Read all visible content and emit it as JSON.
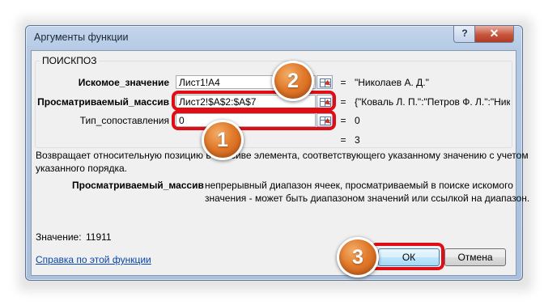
{
  "window": {
    "title": "Аргументы функции",
    "help_glyph": "?",
    "close_glyph": "✕"
  },
  "function_name": "ПОИСКПОЗ",
  "args": [
    {
      "label": "Искомое_значение",
      "bold": true,
      "value": "Лист1!A4",
      "result": "\"Николаев А. Д.\""
    },
    {
      "label": "Просматриваемый_массив",
      "bold": true,
      "value": "Лист2!$A$2:$A$7",
      "result": "{\"Коваль Л. П.\":\"Петров Ф. Л.\":\"Ник"
    },
    {
      "label": "Тип_сопоставления",
      "bold": false,
      "value": "0",
      "result": "0"
    }
  ],
  "equals_sign": "=",
  "total_result": "3",
  "description": {
    "line1": "Возвращает относительную позицию в массиве элемента, соответствующего указанному значению с учетом",
    "line2": "указанного порядка."
  },
  "arg_help": {
    "name": "Просматриваемый_массив",
    "line1": "непрерывный диапазон ячеек, просматриваемый в поиске искомого",
    "line2": "значения - может быть диапазоном значений или ссылкой на диапазон."
  },
  "value_line": {
    "label": "Значение:",
    "value": "11911"
  },
  "help_link": "Справка по этой функции",
  "buttons": {
    "ok": "ОК",
    "cancel": "Отмена"
  },
  "callouts": {
    "one": "1",
    "two": "2",
    "three": "3"
  },
  "accent_colors": {
    "callout_red": "#e10d15",
    "badge_orange": "#e27a2b"
  }
}
